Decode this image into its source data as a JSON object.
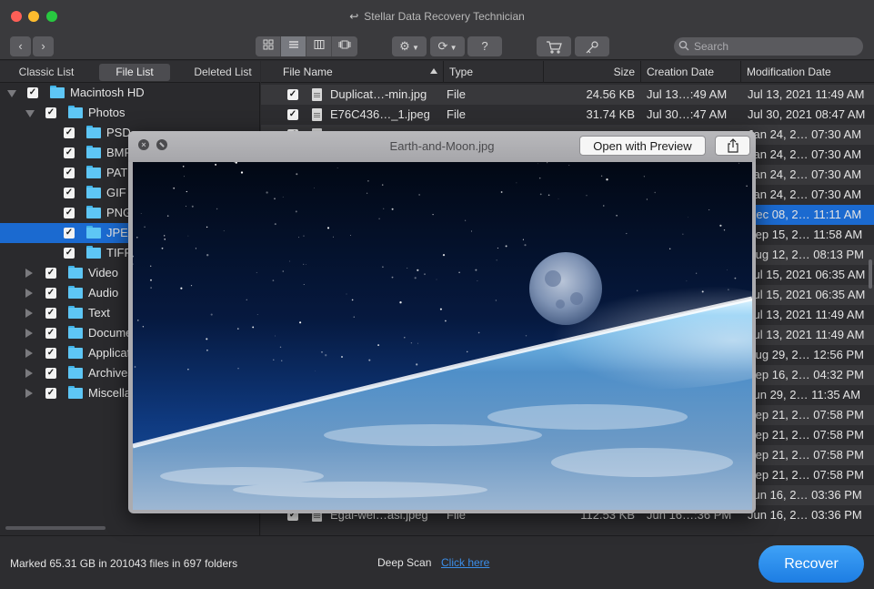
{
  "window": {
    "title": "Stellar Data Recovery Technician"
  },
  "toolbar": {
    "search_placeholder": "Search",
    "help_label": "?"
  },
  "left_panel": {
    "tabs": [
      "Classic List",
      "File List",
      "Deleted List"
    ],
    "active_tab": "File List",
    "tree": [
      {
        "label": "Macintosh HD",
        "level": 0,
        "expanded": true
      },
      {
        "label": "Photos",
        "level": 1,
        "expanded": true
      },
      {
        "label": "PSD",
        "level": 2
      },
      {
        "label": "BMP",
        "level": 2
      },
      {
        "label": "PAT",
        "level": 2
      },
      {
        "label": "GIF",
        "level": 2
      },
      {
        "label": "PNG",
        "level": 2
      },
      {
        "label": "JPEG",
        "level": 2,
        "selected": true
      },
      {
        "label": "TIFF",
        "level": 2
      },
      {
        "label": "Video",
        "level": 1,
        "expanded": false
      },
      {
        "label": "Audio",
        "level": 1,
        "expanded": false
      },
      {
        "label": "Text",
        "level": 1,
        "expanded": false
      },
      {
        "label": "Documents",
        "level": 1,
        "expanded": false
      },
      {
        "label": "Applications",
        "level": 1,
        "expanded": false
      },
      {
        "label": "Archives",
        "level": 1,
        "expanded": false
      },
      {
        "label": "Miscellaneous",
        "level": 1,
        "expanded": false
      }
    ]
  },
  "table": {
    "columns": [
      "File Name",
      "Type",
      "Size",
      "Creation Date",
      "Modification Date"
    ],
    "rows": [
      {
        "name": "Duplicat…-min.jpg",
        "type": "File",
        "size": "24.56 KB",
        "created": "Jul 13…:49 AM",
        "modified": "Jul 13, 2021 11:49 AM"
      },
      {
        "name": "E76C436…_1.jpeg",
        "type": "File",
        "size": "31.74 KB",
        "created": "Jul 30…:47 AM",
        "modified": "Jul 30, 2021 08:47 AM"
      },
      {
        "name": "",
        "type": "",
        "size": "",
        "created": "",
        "modified": "Jan 24, 2… 07:30 AM"
      },
      {
        "name": "",
        "type": "",
        "size": "",
        "created": "",
        "modified": "Jan 24, 2… 07:30 AM"
      },
      {
        "name": "",
        "type": "",
        "size": "",
        "created": "",
        "modified": "Jan 24, 2… 07:30 AM"
      },
      {
        "name": "",
        "type": "",
        "size": "",
        "created": "",
        "modified": "Jan 24, 2… 07:30 AM"
      },
      {
        "name": "",
        "type": "",
        "size": "",
        "created": "",
        "modified": "Dec 08, 2… 11:11 AM",
        "selected": true
      },
      {
        "name": "",
        "type": "",
        "size": "",
        "created": "",
        "modified": "Sep 15, 2… 11:58 AM"
      },
      {
        "name": "",
        "type": "",
        "size": "",
        "created": "",
        "modified": "Aug 12, 2… 08:13 PM"
      },
      {
        "name": "",
        "type": "",
        "size": "",
        "created": "",
        "modified": "Jul 15, 2021 06:35 AM"
      },
      {
        "name": "",
        "type": "",
        "size": "",
        "created": "",
        "modified": "Jul 15, 2021 06:35 AM"
      },
      {
        "name": "",
        "type": "",
        "size": "",
        "created": "",
        "modified": "Jul 13, 2021 11:49 AM"
      },
      {
        "name": "",
        "type": "",
        "size": "",
        "created": "",
        "modified": "Jul 13, 2021 11:49 AM"
      },
      {
        "name": "",
        "type": "",
        "size": "",
        "created": "",
        "modified": "Aug 29, 2… 12:56 PM"
      },
      {
        "name": "",
        "type": "",
        "size": "",
        "created": "",
        "modified": "Sep 16, 2… 04:32 PM"
      },
      {
        "name": "",
        "type": "",
        "size": "",
        "created": "",
        "modified": "Jun 29, 2… 11:35 AM"
      },
      {
        "name": "",
        "type": "",
        "size": "",
        "created": "",
        "modified": "Sep 21, 2… 07:58 PM"
      },
      {
        "name": "",
        "type": "",
        "size": "",
        "created": "",
        "modified": "Sep 21, 2… 07:58 PM"
      },
      {
        "name": "",
        "type": "",
        "size": "",
        "created": "",
        "modified": "Sep 21, 2… 07:58 PM"
      },
      {
        "name": "",
        "type": "",
        "size": "",
        "created": "",
        "modified": "Sep 21, 2… 07:58 PM"
      },
      {
        "name": "Egal-wel…lum.jpeg",
        "type": "File",
        "size": "112.53 KB",
        "created": "Jun 16…:36 PM",
        "modified": "Jun 16, 2… 03:36 PM"
      },
      {
        "name": "Egal-wel…asl.jpeg",
        "type": "File",
        "size": "112.53 KB",
        "created": "Jun 16…:36 PM",
        "modified": "Jun 16, 2… 03:36 PM"
      }
    ]
  },
  "quicklook": {
    "title": "Earth-and-Moon.jpg",
    "open_label": "Open with Preview"
  },
  "bottom": {
    "status": "Marked 65.31 GB in 201043 files in 697 folders",
    "deep_scan_label": "Deep Scan",
    "deep_scan_link": "Click here",
    "recover_label": "Recover"
  },
  "colors": {
    "accent": "#1b6ad0",
    "recover_button": "#2a8ff0",
    "folder": "#5ec6f5"
  }
}
